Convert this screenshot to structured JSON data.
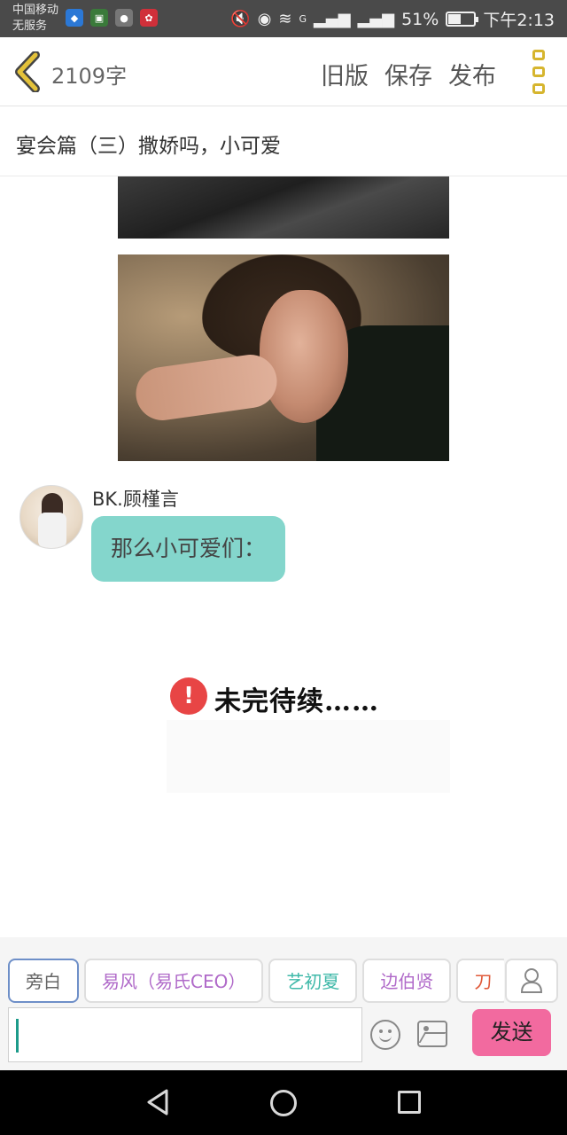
{
  "status_bar": {
    "carrier_line1": "中国移动",
    "carrier_line2": "无服务",
    "network_label": "G",
    "battery_percent": "51%",
    "battery_level": 0.51,
    "time": "下午2:13"
  },
  "toolbar": {
    "word_count": "2109字",
    "old_version_label": "旧版",
    "save_label": "保存",
    "publish_label": "发布"
  },
  "chapter_title": "宴会篇（三）撒娇吗，小可爱",
  "message": {
    "speaker": "BK.顾槿言",
    "text": "那么小可爱们："
  },
  "notice": {
    "badge": "!",
    "text": "未完待续……"
  },
  "character_chips": [
    "旁白",
    "易风（易氏CEO）",
    "艺初夏",
    "边伯贤",
    "刀"
  ],
  "chip_colors": [
    "#666666",
    "#b06ac9",
    "#3fb9a9",
    "#b06ac9",
    "#e05a3a"
  ],
  "input": {
    "value": ""
  },
  "send_label": "发送",
  "icons": {
    "back": "chevron-left-icon",
    "more": "more-vertical-icon",
    "contact": "person-icon",
    "emoji": "smiley-icon",
    "image": "image-icon"
  },
  "colors": {
    "accent_gold": "#d6b52e",
    "bubble": "#84d6cc",
    "send_button": "#f26a9f",
    "warning": "#e84545"
  }
}
